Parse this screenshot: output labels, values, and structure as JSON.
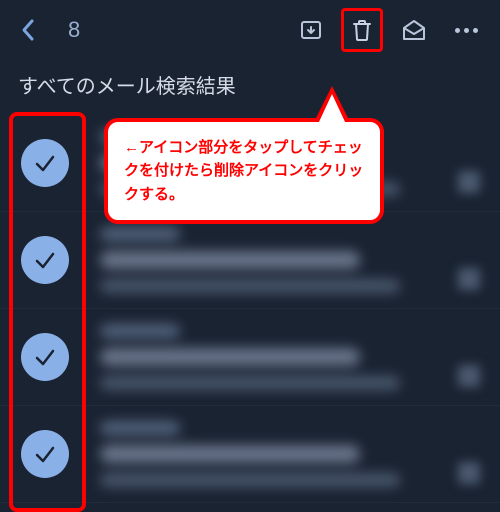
{
  "topbar": {
    "selected_count": "8"
  },
  "subheader": "すべてのメール検索結果",
  "callout_text": "←アイコン部分をタップしてチェックを付けたら削除アイコンをクリックする。",
  "rows": [
    {
      "checked": true
    },
    {
      "checked": true
    },
    {
      "checked": true
    },
    {
      "checked": true
    }
  ],
  "icons": {
    "back": "chevron-left",
    "archive": "archive",
    "delete": "trash",
    "unread": "mail-open",
    "more": "dots"
  },
  "colors": {
    "accent": "#8ab0e8",
    "highlight": "#ff0000",
    "bg": "#1a2332"
  }
}
